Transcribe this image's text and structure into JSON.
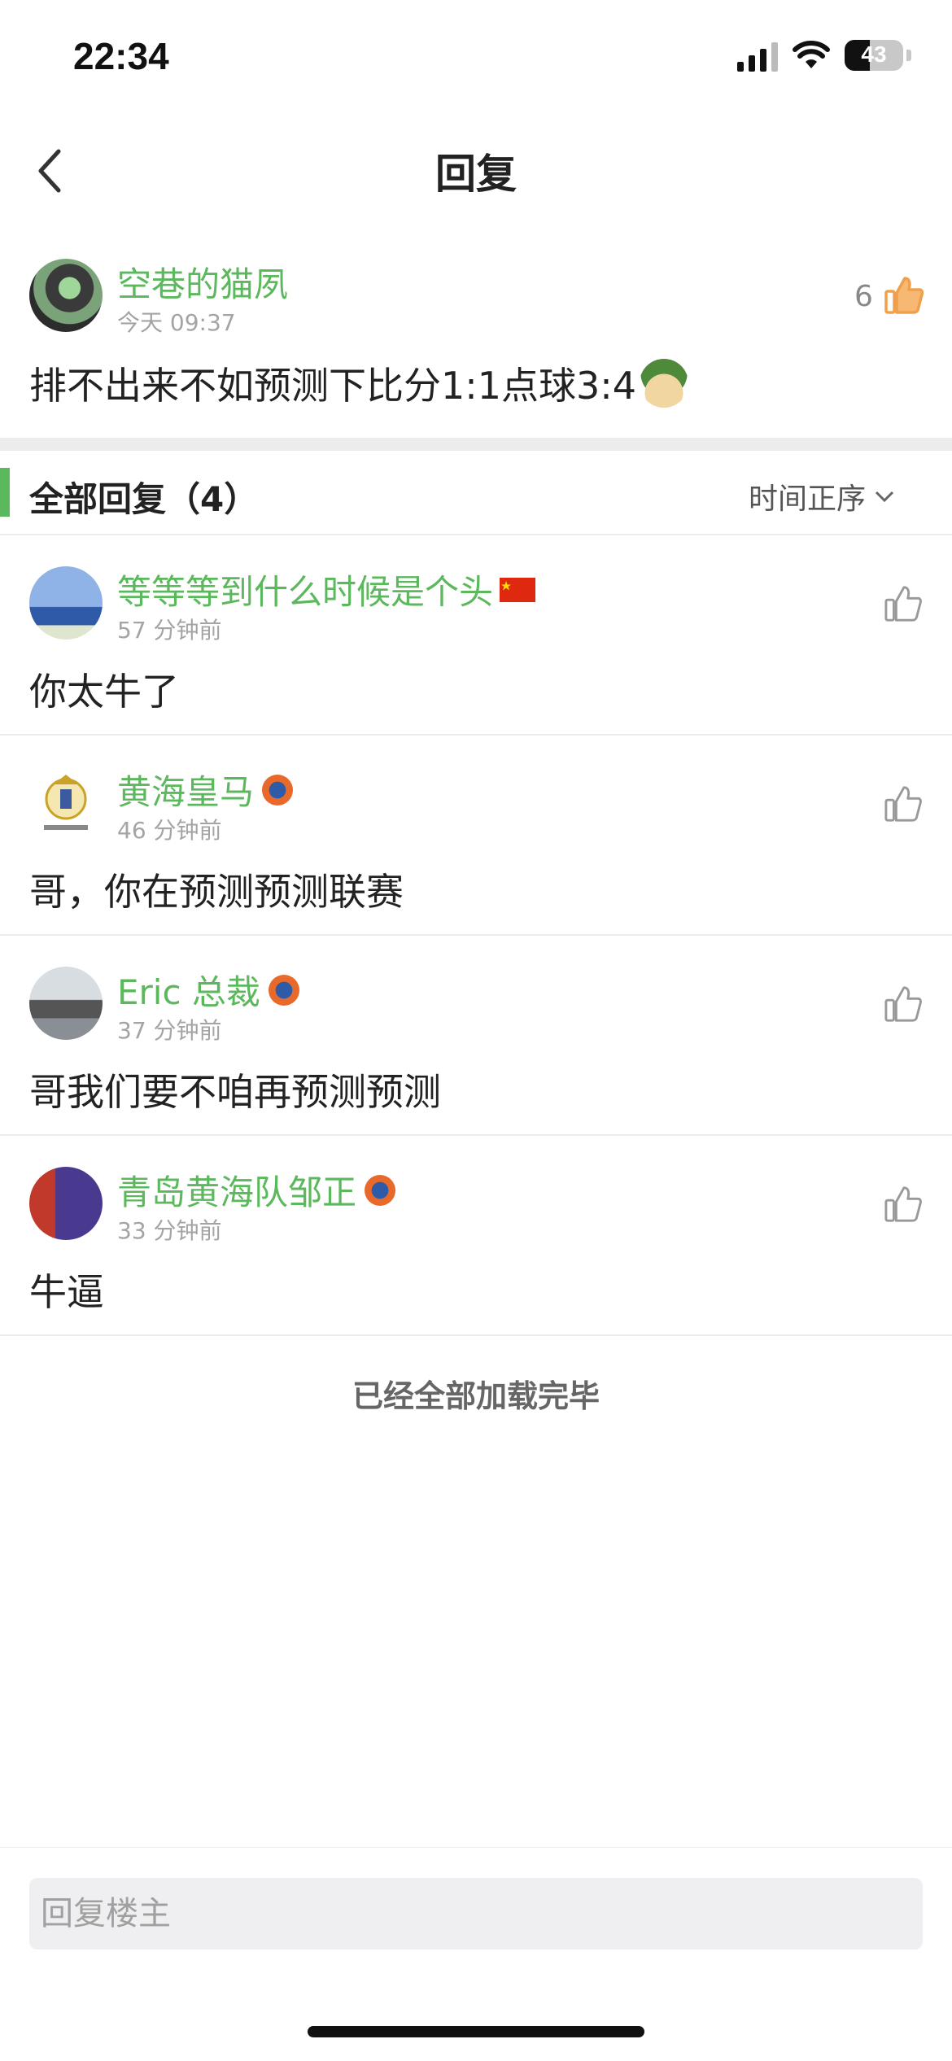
{
  "status": {
    "time": "22:34",
    "battery": "43"
  },
  "nav": {
    "title": "回复"
  },
  "post": {
    "username": "空巷的猫夙",
    "time": "今天 09:37",
    "text": "排不出来不如预测下比分1:1点球3:4",
    "likes": "6"
  },
  "section": {
    "title": "全部回复（4）",
    "sort_label": "时间正序"
  },
  "replies": [
    {
      "username": "等等等到什么时候是个头",
      "time": "57 分钟前",
      "text": "你太牛了",
      "badge": "china-flag-icon"
    },
    {
      "username": "黄海皇马",
      "time": "46 分钟前",
      "text": "哥，你在预测预测联赛",
      "badge": "team-badge-icon"
    },
    {
      "username": "Eric 总裁",
      "time": "37 分钟前",
      "text": "哥我们要不咱再预测预测",
      "badge": "team-badge-icon"
    },
    {
      "username": "青岛黄海队邹正",
      "time": "33 分钟前",
      "text": "牛逼",
      "badge": "team-badge-icon"
    }
  ],
  "footer": {
    "loaded_text": "已经全部加载完毕"
  },
  "input": {
    "placeholder": "回复楼主"
  },
  "colors": {
    "accent": "#5cb85c",
    "like_active": "#f0a04b",
    "icon_gray": "#9a9a9a"
  }
}
